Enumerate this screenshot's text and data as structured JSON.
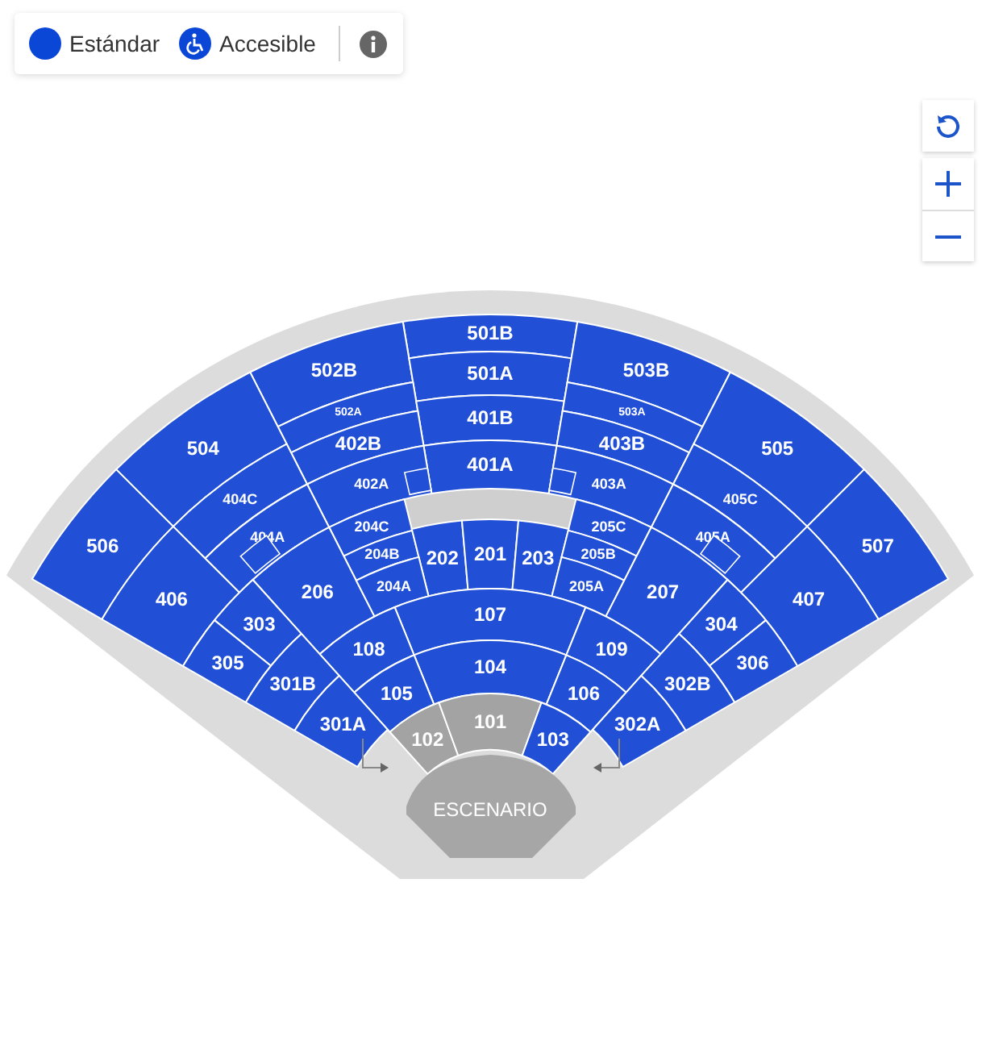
{
  "legend": [
    {
      "kind": "standard",
      "label": "Estándar"
    },
    {
      "kind": "accessible",
      "label": "Accesible"
    }
  ],
  "stage": {
    "label": "ESCENARIO"
  },
  "sections": [
    {
      "label": "501B",
      "available": true
    },
    {
      "label": "502B",
      "available": true
    },
    {
      "label": "501A",
      "available": true
    },
    {
      "label": "503B",
      "available": true
    },
    {
      "label": "502A",
      "available": true
    },
    {
      "label": "401B",
      "available": true
    },
    {
      "label": "503A",
      "available": true
    },
    {
      "label": "504",
      "available": true
    },
    {
      "label": "402B",
      "available": true
    },
    {
      "label": "403B",
      "available": true
    },
    {
      "label": "505",
      "available": true
    },
    {
      "label": "401A",
      "available": true
    },
    {
      "label": "402A",
      "available": true
    },
    {
      "label": "403A",
      "available": true
    },
    {
      "label": "404C",
      "available": true
    },
    {
      "label": "405C",
      "available": true
    },
    {
      "label": "204C",
      "available": true
    },
    {
      "label": "205C",
      "available": true
    },
    {
      "label": "506",
      "available": true
    },
    {
      "label": "404A",
      "available": true
    },
    {
      "label": "405A",
      "available": true
    },
    {
      "label": "507",
      "available": true
    },
    {
      "label": "204B",
      "available": true
    },
    {
      "label": "202",
      "available": true
    },
    {
      "label": "201",
      "available": true
    },
    {
      "label": "203",
      "available": true
    },
    {
      "label": "205B",
      "available": true
    },
    {
      "label": "406",
      "available": true
    },
    {
      "label": "206",
      "available": true
    },
    {
      "label": "204A",
      "available": true
    },
    {
      "label": "205A",
      "available": true
    },
    {
      "label": "207",
      "available": true
    },
    {
      "label": "407",
      "available": true
    },
    {
      "label": "107",
      "available": true
    },
    {
      "label": "303",
      "available": true
    },
    {
      "label": "304",
      "available": true
    },
    {
      "label": "108",
      "available": true
    },
    {
      "label": "109",
      "available": true
    },
    {
      "label": "305",
      "available": true
    },
    {
      "label": "104",
      "available": true
    },
    {
      "label": "306",
      "available": true
    },
    {
      "label": "301B",
      "available": true
    },
    {
      "label": "105",
      "available": true
    },
    {
      "label": "106",
      "available": true
    },
    {
      "label": "302B",
      "available": true
    },
    {
      "label": "301A",
      "available": true
    },
    {
      "label": "102",
      "available": false
    },
    {
      "label": "101",
      "available": false
    },
    {
      "label": "103",
      "available": true
    },
    {
      "label": "302A",
      "available": true
    }
  ]
}
